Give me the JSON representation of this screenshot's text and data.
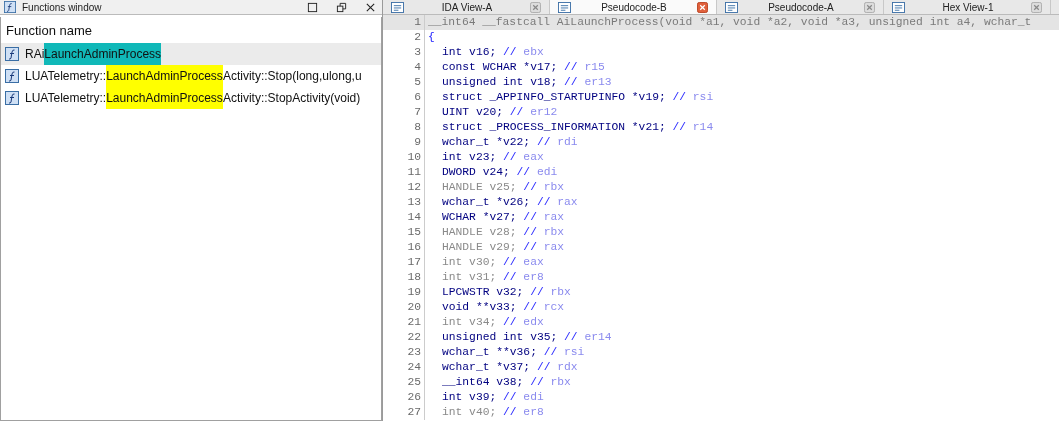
{
  "functions_window": {
    "title": "Functions window",
    "column_header": "Function name",
    "items": [
      {
        "prefix": "RAi",
        "match": "LaunchAdminProcess",
        "selected": true
      },
      {
        "prefix": "LUATelemetry::",
        "match": "LaunchAdminProcess",
        "suffix": "Activity::Stop(long,ulong,u",
        "selected": false
      },
      {
        "prefix": "LUATelemetry::",
        "match": "LaunchAdminProcess",
        "suffix": "Activity::StopActivity(void)",
        "selected": false
      }
    ]
  },
  "tabs": [
    {
      "label": "IDA View-A",
      "selected": false
    },
    {
      "label": "Pseudocode-B",
      "selected": true
    },
    {
      "label": "Pseudocode-A",
      "selected": false
    },
    {
      "label": "Hex View-1",
      "selected": false
    }
  ],
  "code_lines": [
    {
      "kind": "header",
      "number": "1",
      "text": "__int64 __fastcall AiLaunchProcess(void *a1, void *a2, void *a3, unsigned int a4, wchar_t"
    },
    {
      "kind": "brace",
      "number": "2",
      "text": "{"
    },
    {
      "kind": "decl",
      "number": "3",
      "text": "int v16;",
      "comment": "//",
      "register": "ebx",
      "unused": false
    },
    {
      "kind": "decl",
      "number": "4",
      "text": "const WCHAR *v17;",
      "comment": "//",
      "register": "r15",
      "unused": false
    },
    {
      "kind": "decl",
      "number": "5",
      "text": "unsigned int v18;",
      "comment": "//",
      "register": "er13",
      "unused": false
    },
    {
      "kind": "decl",
      "number": "6",
      "text": "struct _APPINFO_STARTUPINFO *v19;",
      "comment": "//",
      "register": "rsi",
      "unused": false
    },
    {
      "kind": "decl",
      "number": "7",
      "text": "UINT v20;",
      "comment": "//",
      "register": "er12",
      "unused": false
    },
    {
      "kind": "decl",
      "number": "8",
      "text": "struct _PROCESS_INFORMATION *v21;",
      "comment": "//",
      "register": "r14",
      "unused": false
    },
    {
      "kind": "decl",
      "number": "9",
      "text": "wchar_t *v22;",
      "comment": "//",
      "register": "rdi",
      "unused": false
    },
    {
      "kind": "decl",
      "number": "10",
      "text": "int v23;",
      "comment": "//",
      "register": "eax",
      "unused": false
    },
    {
      "kind": "decl",
      "number": "11",
      "text": "DWORD v24;",
      "comment": "//",
      "register": "edi",
      "unused": false
    },
    {
      "kind": "decl",
      "number": "12",
      "text": "HANDLE v25;",
      "comment": "//",
      "register": "rbx",
      "unused": true
    },
    {
      "kind": "decl",
      "number": "13",
      "text": "wchar_t *v26;",
      "comment": "//",
      "register": "rax",
      "unused": false
    },
    {
      "kind": "decl",
      "number": "14",
      "text": "WCHAR *v27;",
      "comment": "//",
      "register": "rax",
      "unused": false
    },
    {
      "kind": "decl",
      "number": "15",
      "text": "HANDLE v28;",
      "comment": "//",
      "register": "rbx",
      "unused": true
    },
    {
      "kind": "decl",
      "number": "16",
      "text": "HANDLE v29;",
      "comment": "//",
      "register": "rax",
      "unused": true
    },
    {
      "kind": "decl",
      "number": "17",
      "text": "int v30;",
      "comment": "//",
      "register": "eax",
      "unused": true
    },
    {
      "kind": "decl",
      "number": "18",
      "text": "int v31;",
      "comment": "//",
      "register": "er8",
      "unused": true
    },
    {
      "kind": "decl",
      "number": "19",
      "text": "LPCWSTR v32;",
      "comment": "//",
      "register": "rbx",
      "unused": false
    },
    {
      "kind": "decl",
      "number": "20",
      "text": "void **v33;",
      "comment": "//",
      "register": "rcx",
      "unused": false
    },
    {
      "kind": "decl",
      "number": "21",
      "text": "int v34;",
      "comment": "//",
      "register": "edx",
      "unused": true
    },
    {
      "kind": "decl",
      "number": "22",
      "text": "unsigned int v35;",
      "comment": "//",
      "register": "er14",
      "unused": false
    },
    {
      "kind": "decl",
      "number": "23",
      "text": "wchar_t **v36;",
      "comment": "//",
      "register": "rsi",
      "unused": false
    },
    {
      "kind": "decl",
      "number": "24",
      "text": "wchar_t *v37;",
      "comment": "//",
      "register": "rdx",
      "unused": false
    },
    {
      "kind": "decl",
      "number": "25",
      "text": "__int64 v38;",
      "comment": "//",
      "register": "rbx",
      "unused": false
    },
    {
      "kind": "decl",
      "number": "26",
      "text": "int v39;",
      "comment": "//",
      "register": "edi",
      "unused": false
    },
    {
      "kind": "decl",
      "number": "27",
      "text": "int v40;",
      "comment": "//",
      "register": "er8",
      "unused": true
    }
  ]
}
